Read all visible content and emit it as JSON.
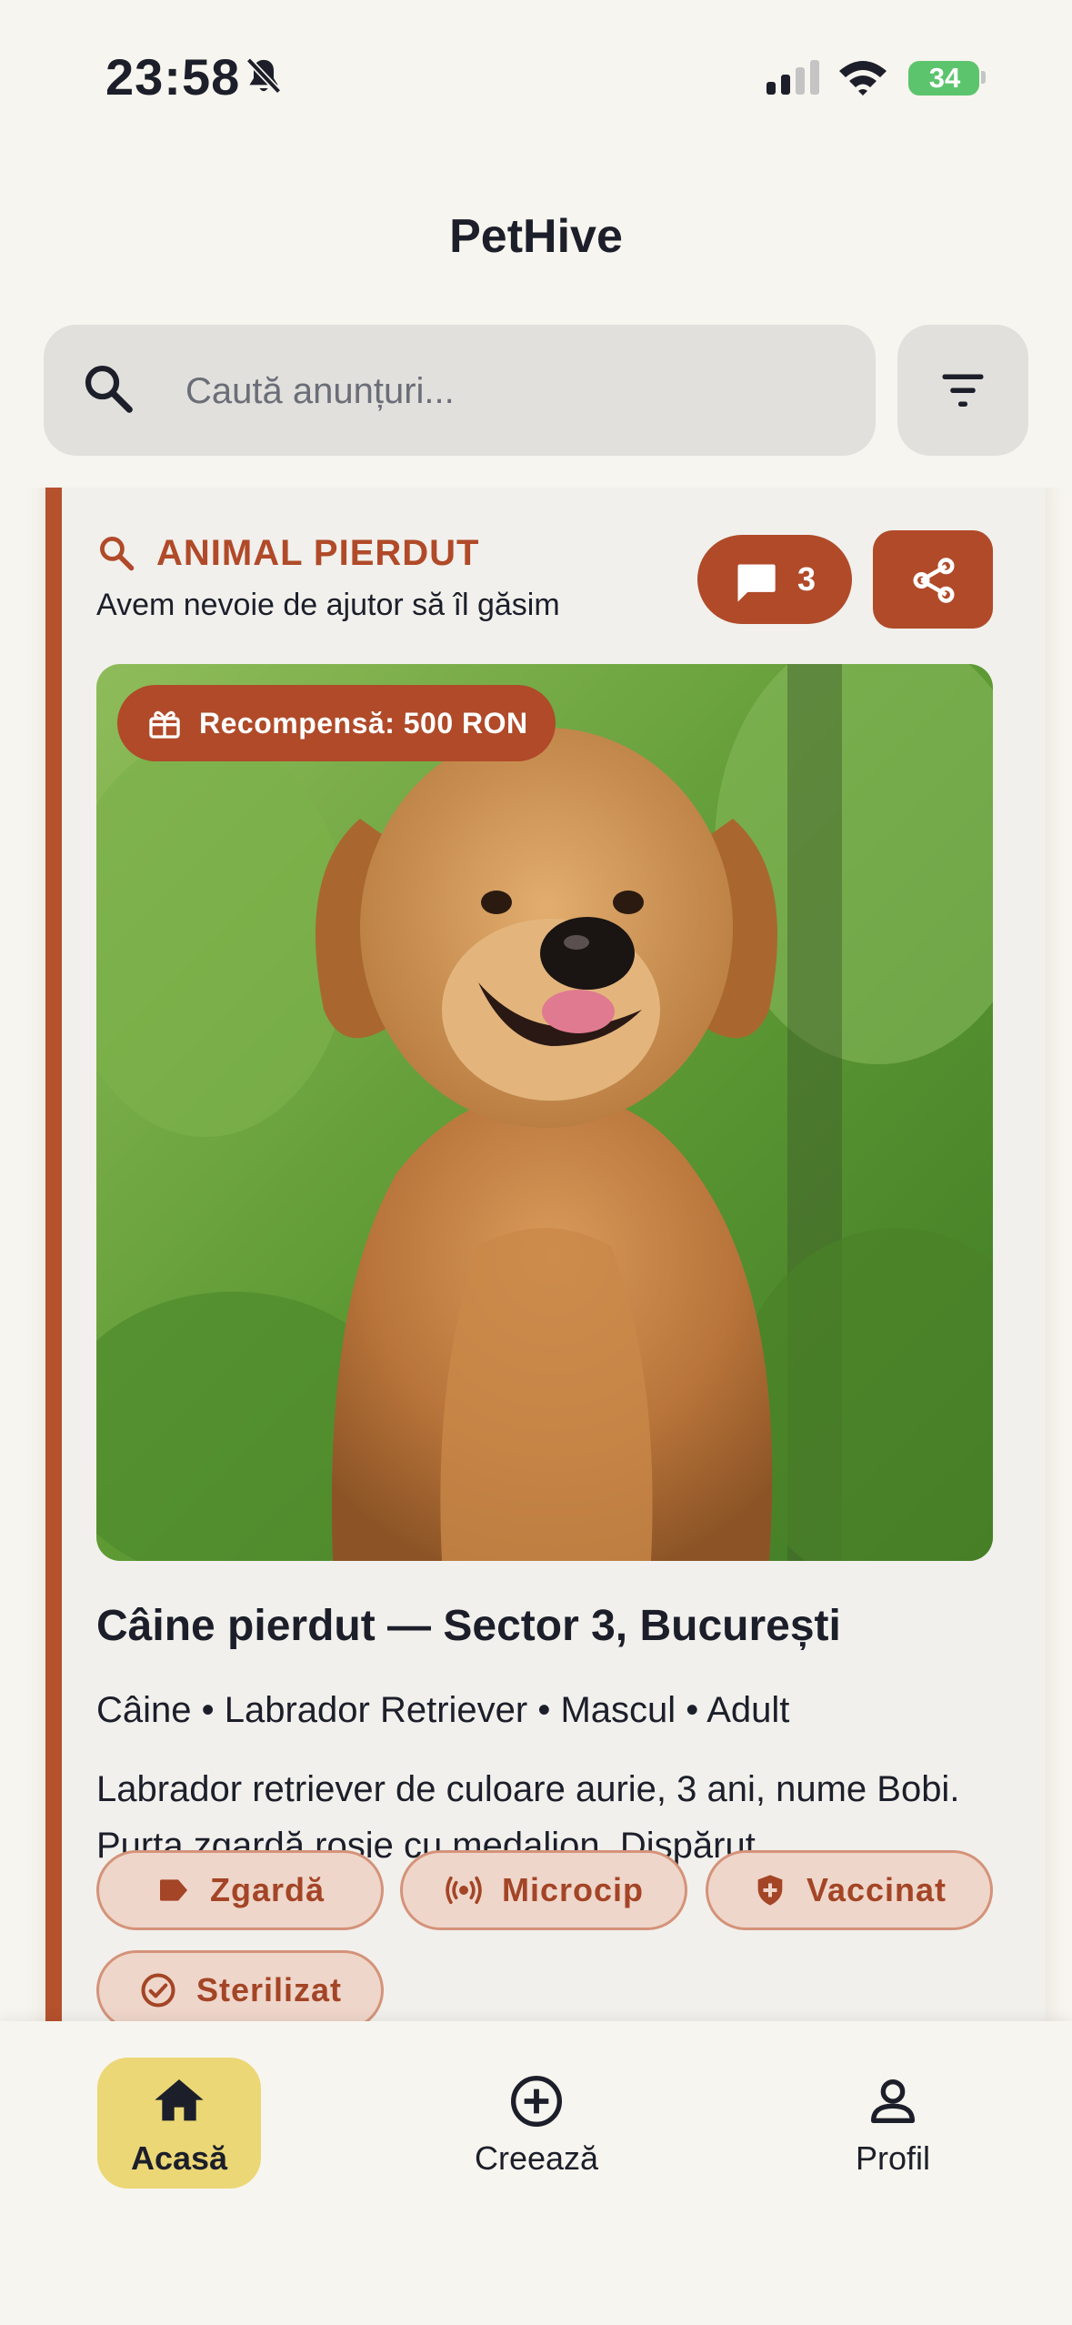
{
  "status_bar": {
    "time": "23:58",
    "battery": "34"
  },
  "header": {
    "title": "PetHive"
  },
  "search": {
    "placeholder": "Caută anunțuri..."
  },
  "listing": {
    "category": "ANIMAL PIERDUT",
    "subtitle": "Avem nevoie de ajutor să îl găsim",
    "comments_count": "3",
    "reward": "Recompensă: 500 RON",
    "title": "Câine pierdut — Sector 3, București",
    "details": "Câine • Labrador Retriever • Mascul • Adult",
    "description": "Labrador retriever de culoare aurie, 3 ani, nume Bobi. Purta zgardă roșie cu medalion. Dispărut...",
    "tags": [
      "Zgardă",
      "Microcip",
      "Vaccinat",
      "Sterilizat"
    ]
  },
  "nav": {
    "items": [
      {
        "label": "Acasă",
        "icon": "home-icon",
        "active": true
      },
      {
        "label": "Creează",
        "icon": "add-circle-icon",
        "active": false
      },
      {
        "label": "Profil",
        "icon": "person-icon",
        "active": false
      }
    ]
  },
  "colors": {
    "accent": "#b04a29",
    "nav_active": "#ecd776",
    "tag_bg": "#efd6ca",
    "background": "#f7f5ef"
  }
}
